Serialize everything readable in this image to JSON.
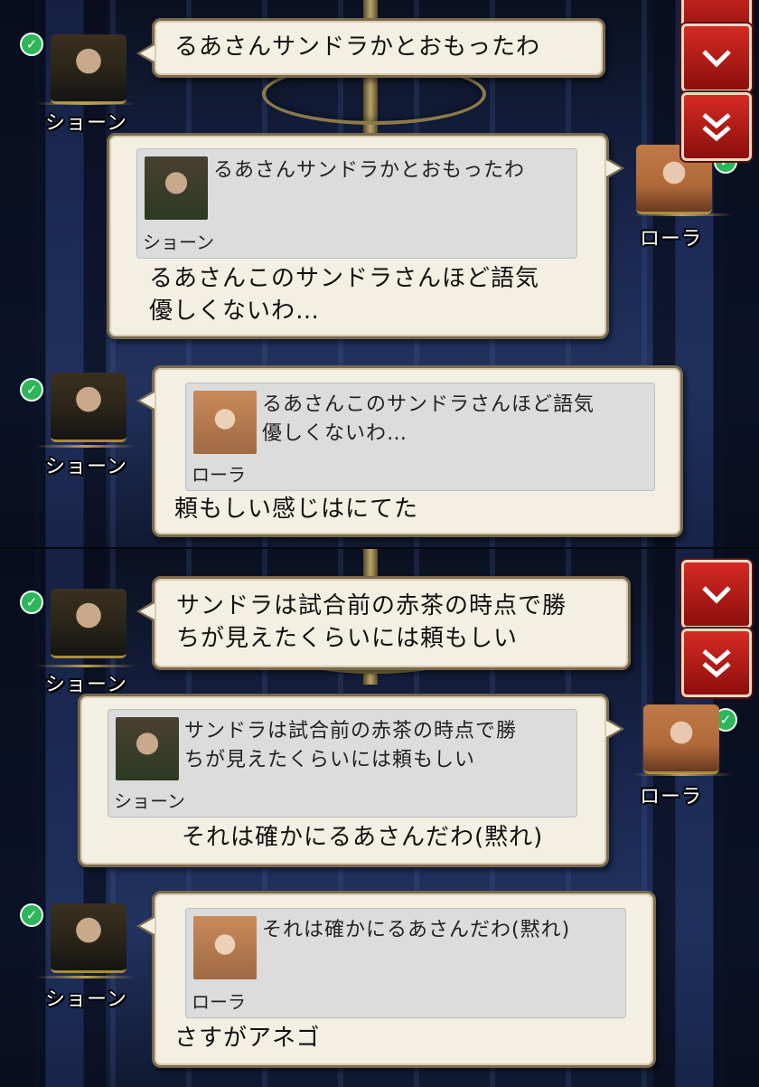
{
  "characters": {
    "sean": "ショーン",
    "laura": "ローラ"
  },
  "messages": [
    {
      "speaker": "ショーン",
      "text_lines": [
        "るあさんサンドラかとおもったわ"
      ]
    },
    {
      "speaker": "ローラ",
      "quote": {
        "speaker": "ショーン",
        "lines": [
          "るあさんサンドラかとおもったわ"
        ]
      },
      "text_lines": [
        "るあさんこのサンドラさんほど語気",
        "優しくないわ…"
      ]
    },
    {
      "speaker": "ショーン",
      "quote": {
        "speaker": "ローラ",
        "lines": [
          "るあさんこのサンドラさんほど語気",
          "優しくないわ…"
        ]
      },
      "text_lines": [
        "頼もしい感じはにてた"
      ]
    },
    {
      "speaker": "ショーン",
      "text_lines": [
        "サンドラは試合前の赤茶の時点で勝",
        "ちが見えたくらいには頼もしい"
      ]
    },
    {
      "speaker": "ローラ",
      "quote": {
        "speaker": "ショーン",
        "lines": [
          "サンドラは試合前の赤茶の時点で勝",
          "ちが見えたくらいには頼もしい"
        ]
      },
      "text_lines": [
        "それは確かにるあさんだわ(黙れ)"
      ]
    },
    {
      "speaker": "ショーン",
      "quote": {
        "speaker": "ローラ",
        "lines": [
          "それは確かにるあさんだわ(黙れ)"
        ]
      },
      "text_lines": [
        "さすがアネゴ"
      ]
    }
  ],
  "colors": {
    "accent_red": "#d62a24",
    "check_green": "#2fb55a",
    "bubble_bg": "#f4efe3"
  },
  "icons": [
    "check-icon",
    "chevron-down-icon",
    "double-chevron-down-icon"
  ]
}
